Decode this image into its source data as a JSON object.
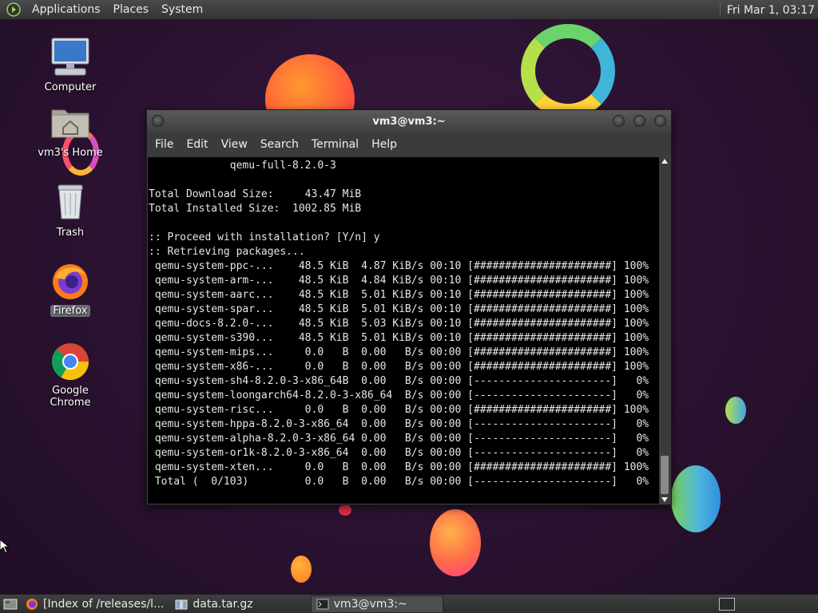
{
  "top_panel": {
    "menus": [
      "Applications",
      "Places",
      "System"
    ],
    "clock": "Fri Mar 1, 03:17"
  },
  "desktop_icons": [
    {
      "label": "Computer",
      "icon": "computer-icon"
    },
    {
      "label": "vm3's Home",
      "icon": "home-folder-icon"
    },
    {
      "label": "Trash",
      "icon": "trash-icon"
    },
    {
      "label": "Firefox",
      "icon": "firefox-icon",
      "selected": true
    },
    {
      "label": "Google Chrome",
      "icon": "chrome-icon"
    }
  ],
  "terminal": {
    "title": "vm3@vm3:~",
    "menus": [
      "File",
      "Edit",
      "View",
      "Search",
      "Terminal",
      "Help"
    ],
    "lines": [
      "             qemu-full-8.2.0-3",
      "",
      "Total Download Size:     43.47 MiB",
      "Total Installed Size:  1002.85 MiB",
      "",
      ":: Proceed with installation? [Y/n] y",
      ":: Retrieving packages...",
      " qemu-system-ppc-...    48.5 KiB  4.87 KiB/s 00:10 [######################] 100%",
      " qemu-system-arm-...    48.5 KiB  4.84 KiB/s 00:10 [######################] 100%",
      " qemu-system-aarc...    48.5 KiB  5.01 KiB/s 00:10 [######################] 100%",
      " qemu-system-spar...    48.5 KiB  5.01 KiB/s 00:10 [######################] 100%",
      " qemu-docs-8.2.0-...    48.5 KiB  5.03 KiB/s 00:10 [######################] 100%",
      " qemu-system-s390...    48.5 KiB  5.01 KiB/s 00:10 [######################] 100%",
      " qemu-system-mips...     0.0   B  0.00   B/s 00:00 [######################] 100%",
      " qemu-system-x86-...     0.0   B  0.00   B/s 00:00 [######################] 100%",
      " qemu-system-sh4-8.2.0-3-x86_64B  0.00   B/s 00:00 [----------------------]   0%",
      " qemu-system-loongarch64-8.2.0-3-x86_64  B/s 00:00 [----------------------]   0%",
      " qemu-system-risc...     0.0   B  0.00   B/s 00:00 [######################] 100%",
      " qemu-system-hppa-8.2.0-3-x86_64  0.00   B/s 00:00 [----------------------]   0%",
      " qemu-system-alpha-8.2.0-3-x86_64 0.00   B/s 00:00 [----------------------]   0%",
      " qemu-system-or1k-8.2.0-3-x86_64  0.00   B/s 00:00 [----------------------]   0%",
      " qemu-system-xten...     0.0   B  0.00   B/s 00:00 [######################] 100%",
      " Total (  0/103)         0.0   B  0.00   B/s 00:00 [----------------------]   0%"
    ]
  },
  "taskbar": [
    {
      "label": "[Index of /releases/l...",
      "icon": "firefox-icon",
      "active": false
    },
    {
      "label": "data.tar.gz",
      "icon": "archive-icon",
      "active": false
    },
    {
      "label": "vm3@vm3:~",
      "icon": "terminal-icon",
      "active": true
    }
  ],
  "colors": {
    "background": "#2a1330",
    "panel": "#3b3b3b",
    "terminal_bg": "#000000",
    "terminal_fg": "#e6e6e6"
  }
}
